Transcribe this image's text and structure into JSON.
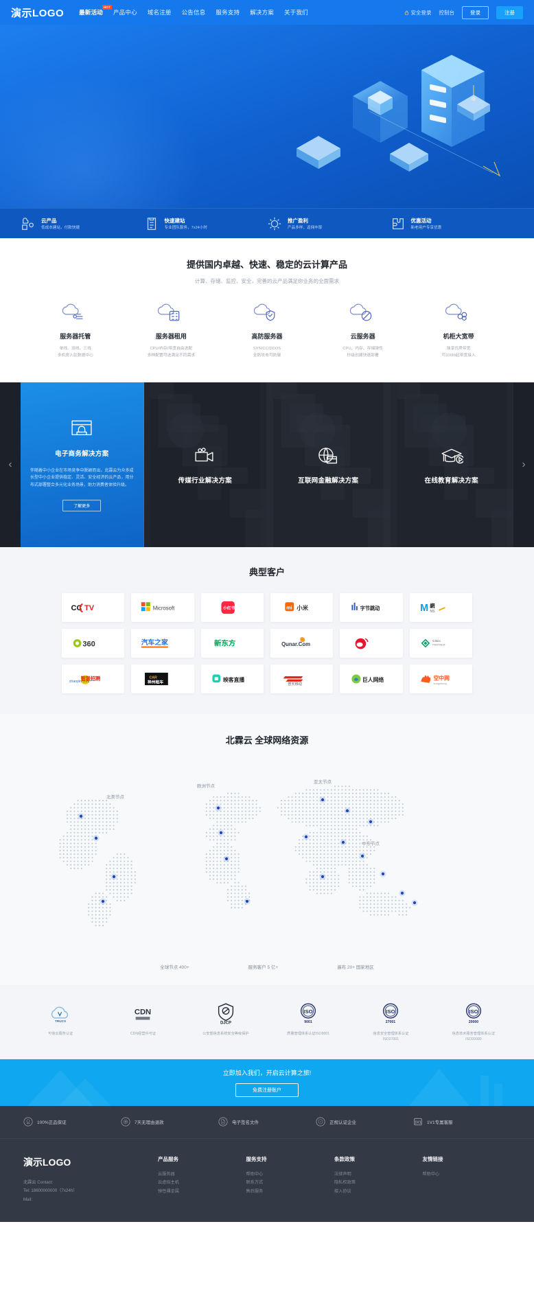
{
  "header": {
    "logo": "演示LOGO",
    "nav": [
      {
        "label": "最新活动",
        "badge": "HOT",
        "active": true
      },
      {
        "label": "产品中心",
        "badge": "",
        "active": false
      },
      {
        "label": "域名注册",
        "badge": "",
        "active": false
      },
      {
        "label": "公告信息",
        "badge": "",
        "active": false
      },
      {
        "label": "服务支持",
        "badge": "",
        "active": false
      },
      {
        "label": "解决方案",
        "badge": "",
        "active": false
      },
      {
        "label": "关于我们",
        "badge": "",
        "active": false
      }
    ],
    "secure_label": "安全登录",
    "console_label": "控制台",
    "login_label": "登录",
    "register_label": "注册"
  },
  "featurebar": [
    {
      "icon": "cloud-product-icon",
      "title": "云产品",
      "sub": "低成本建站，付款快捷"
    },
    {
      "icon": "clipboard-icon",
      "title": "快速建站",
      "sub": "专业团队服务，7x24小时"
    },
    {
      "icon": "network-icon",
      "title": "推广盈利",
      "sub": "产品多样，返佣丰厚"
    },
    {
      "icon": "puzzle-icon",
      "title": "优惠活动",
      "sub": "新老用户专享优惠"
    }
  ],
  "products": {
    "title": "提供国内卓越、快速、稳定的云计算产品",
    "subtitle": "计算、存储、监控、安全，完善的云产品满足你业务的全面需求",
    "items": [
      {
        "icon": "cloud-hosting-icon",
        "name": "服务器托管",
        "desc": "单线、双线、三线\n多机房入驻数据中心"
      },
      {
        "icon": "cloud-rent-icon",
        "name": "服务器租用",
        "desc": "CPU/内存/带宽自由选配\n多种配置可选满足不同需求"
      },
      {
        "icon": "cloud-shield-icon",
        "name": "高防服务器",
        "desc": "SYN/CC/DDOS\n全防攻击可防御"
      },
      {
        "icon": "cloud-server-icon",
        "name": "云服务器",
        "desc": "CPU、内存、存储弹性\n秒级创建快速部署"
      },
      {
        "icon": "cloud-bandwidth-icon",
        "name": "机柜大宽带",
        "desc": "独享优质带宽\n可100M起带宽接入"
      }
    ]
  },
  "solutions": {
    "prev_label": "‹",
    "next_label": "›",
    "items": [
      {
        "icon": "browser-lock-icon",
        "title": "电子商务解决方案",
        "desc": "伴随着中小企业在市场竞争中脱颖而出，北霖云为众多成长型中小企业提供稳定、灵活、安全经济的云产品，用分布式部署整合多元化业务场景，助力消费者体验升级。",
        "button": "了解更多",
        "active": true
      },
      {
        "icon": "video-camera-icon",
        "title": "传媒行业解决方案",
        "desc": "",
        "button": "",
        "active": false
      },
      {
        "icon": "globe-card-icon",
        "title": "互联网金融解决方案",
        "desc": "",
        "button": "",
        "active": false
      },
      {
        "icon": "graduation-play-icon",
        "title": "在线教育解决方案",
        "desc": "",
        "button": "",
        "active": false
      }
    ]
  },
  "clients": {
    "title": "典型客户",
    "logos": [
      {
        "name": "CCTV",
        "kind": "cctv"
      },
      {
        "name": "Microsoft",
        "kind": "microsoft"
      },
      {
        "name": "小红书",
        "kind": "xiaohongshu"
      },
      {
        "name": "小米",
        "kind": "xiaomi"
      },
      {
        "name": "字节跳动",
        "kind": "bytedance"
      },
      {
        "name": "M網",
        "kind": "mwang"
      },
      {
        "name": "360",
        "kind": "n360"
      },
      {
        "name": "汽车之家",
        "kind": "autohome"
      },
      {
        "name": "新东方",
        "kind": "xindongfang"
      },
      {
        "name": "Qunar.Com",
        "kind": "qunar"
      },
      {
        "name": "微博",
        "kind": "weibo"
      },
      {
        "name": "Cisco",
        "kind": "cisco"
      },
      {
        "name": "zhaopin.com",
        "kind": "zhaopin"
      },
      {
        "name": "神州租车",
        "kind": "shenzhou"
      },
      {
        "name": "映客直播",
        "kind": "yingke"
      },
      {
        "name": "普天移动",
        "kind": "putian"
      },
      {
        "name": "巨人网络",
        "kind": "giant"
      },
      {
        "name": "空中网",
        "kind": "kongzhong"
      }
    ]
  },
  "map": {
    "title": "北霖云 全球网络资源",
    "labels": [
      "北美节点",
      "欧洲节点",
      "亚太节点",
      "中东节点"
    ],
    "stats": [
      "全球节点 400+",
      "服务客户 5 亿+",
      "遍布 20+ 国家地区"
    ]
  },
  "certs": [
    {
      "icon": "trucs-icon",
      "label": "可信云服务认证"
    },
    {
      "icon": "cdn-icon",
      "label": "CDN经营许可证"
    },
    {
      "icon": "djcp-icon",
      "label": "公安部信息系统安全等级保护"
    },
    {
      "icon": "iso-9001-icon",
      "label": "质量管理体系认证ISO9001",
      "code": "9001"
    },
    {
      "icon": "iso-27001-icon",
      "label": "信息安全管理体系认证\nISO27001",
      "code": "27001"
    },
    {
      "icon": "iso-20000-icon",
      "label": "信息技术服务管理体系认证\nISO20000",
      "code": "20000"
    }
  ],
  "cta": {
    "title": "立即加入我们，开启云计算之旅!",
    "button": "免费注册账户"
  },
  "service_strip": [
    {
      "icon": "medal-icon",
      "label": "100%正品保证"
    },
    {
      "icon": "refund-icon",
      "label": "7天无理由退款"
    },
    {
      "icon": "contract-icon",
      "label": "电子签名文件"
    },
    {
      "icon": "certified-icon",
      "label": "正规认证企业"
    },
    {
      "icon": "one-to-one-icon",
      "label": "1V1专属客服"
    }
  ],
  "footer": {
    "logo": "演示LOGO",
    "contact_lines": [
      "北霖云 Contact:",
      "Tel: 18600000000（7x24h）",
      "Mail:"
    ],
    "columns": [
      {
        "title": "产品服务",
        "links": [
          "云服务器",
          "云虚拟主机",
          "弹性裸金属"
        ]
      },
      {
        "title": "服务支持",
        "links": [
          "帮助中心",
          "联系方式",
          "售后服务"
        ]
      },
      {
        "title": "条款政策",
        "links": [
          "法律声明",
          "隐私权政策",
          "接入协议"
        ]
      },
      {
        "title": "友情链接",
        "links": [
          "帮助中心"
        ]
      }
    ]
  },
  "colors": {
    "brand": "#1578ec",
    "cta": "#0fa8f0",
    "dark": "#343a45"
  }
}
